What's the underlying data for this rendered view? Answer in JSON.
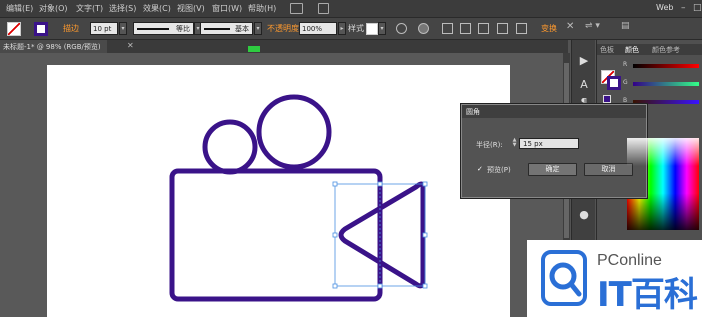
{
  "menubar": {
    "items": [
      "编辑(E)",
      "对象(O)",
      "文字(T)",
      "选择(S)",
      "效果(C)",
      "视图(V)",
      "窗口(W)",
      "帮助(H)"
    ],
    "workspace": "Web"
  },
  "controlbar": {
    "stroke_label": "描边",
    "stroke_weight": "10 pt",
    "profile_1": "等比",
    "profile_2": "基本",
    "opacity_label": "不透明度",
    "opacity_value": "100%",
    "style_label": "样式",
    "transform_label": "变换"
  },
  "document": {
    "tab_title": "未标题-1* @ 98% (RGB/预览)",
    "artwork": {
      "stroke_color": "#3a1389",
      "selection_color": "#4a90e2"
    }
  },
  "panel": {
    "tabs": [
      "色板",
      "颜色",
      "颜色参考"
    ],
    "channels": [
      "R",
      "G",
      "B"
    ]
  },
  "dialog": {
    "title": "圆角",
    "radius_label": "半径(R):",
    "radius_value": "15 px",
    "preview_check": "✓",
    "preview_label": "预览(P)",
    "ok_label": "确定",
    "cancel_label": "取消"
  },
  "watermark": {
    "brand": "PConline",
    "name": "IT百科"
  }
}
